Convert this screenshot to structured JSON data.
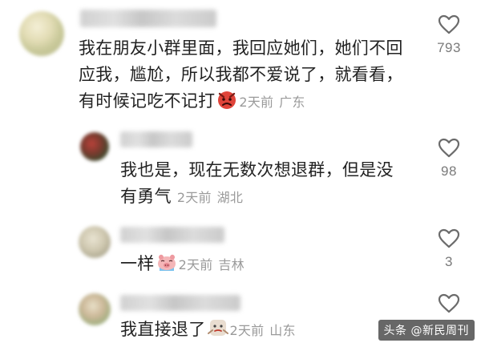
{
  "comments": [
    {
      "lines": [
        "我在朋友小群里面，我回应她们，她们不回",
        "应我，尴尬，所以我都不爱说了，就看看，",
        "有时候记吃不记打"
      ],
      "emoji": "angry-face-emoji",
      "time": "2天前",
      "location": "广东",
      "likes": "793"
    },
    {
      "lines": [
        "我也是，现在无数次想退群，但是没",
        "有勇气"
      ],
      "time": "2天前",
      "location": "湖北",
      "likes": "98"
    },
    {
      "lines": [
        "一样"
      ],
      "emoji": "crying-pig-emoji",
      "time": "2天前",
      "location": "吉林",
      "likes": "3"
    },
    {
      "lines": [
        "我直接退了"
      ],
      "emoji": "shrug-face-emoji",
      "time": "2天前",
      "location": "山东",
      "likes": ""
    }
  ],
  "watermark": "头条 @新民周刊",
  "colors": {
    "meta": "#9a9a9a",
    "text": "#222222",
    "heart": "#6b6b6b"
  }
}
